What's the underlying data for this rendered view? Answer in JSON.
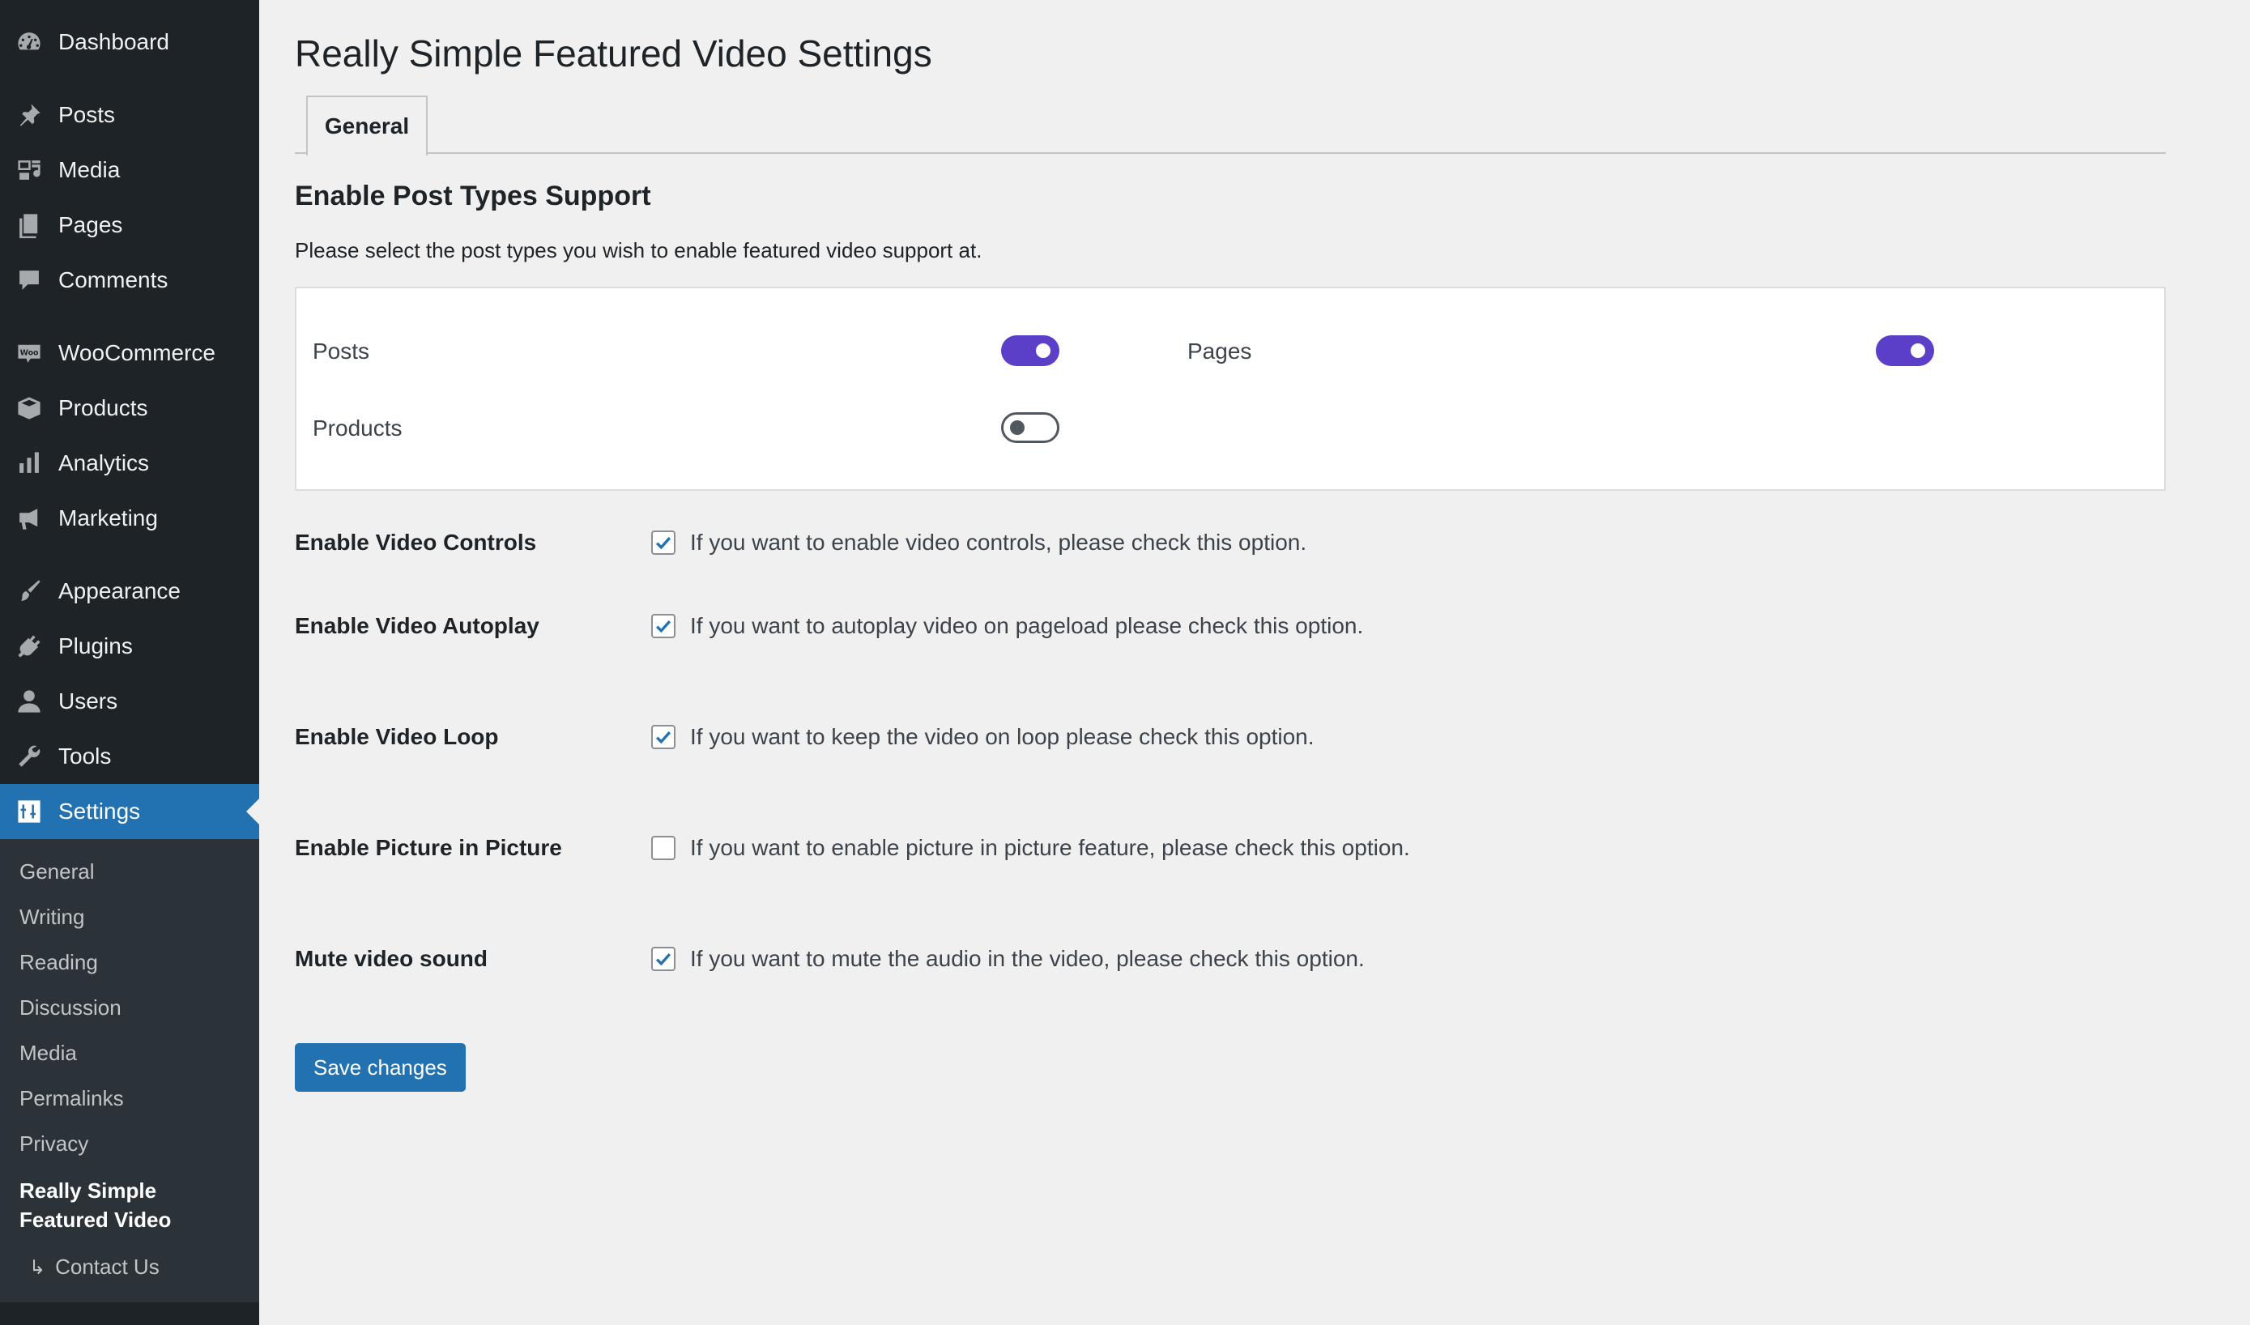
{
  "sidebar": {
    "group1": [
      {
        "label": "Dashboard",
        "icon": "dashboard-icon"
      }
    ],
    "group2": [
      {
        "label": "Posts",
        "icon": "pin-icon"
      },
      {
        "label": "Media",
        "icon": "media-icon"
      },
      {
        "label": "Pages",
        "icon": "pages-icon"
      },
      {
        "label": "Comments",
        "icon": "comment-icon"
      }
    ],
    "group3": [
      {
        "label": "WooCommerce",
        "icon": "woo-icon"
      },
      {
        "label": "Products",
        "icon": "box-icon"
      },
      {
        "label": "Analytics",
        "icon": "bar-chart-icon"
      },
      {
        "label": "Marketing",
        "icon": "megaphone-icon"
      }
    ],
    "group4": [
      {
        "label": "Appearance",
        "icon": "brush-icon"
      },
      {
        "label": "Plugins",
        "icon": "plug-icon"
      },
      {
        "label": "Users",
        "icon": "user-icon"
      },
      {
        "label": "Tools",
        "icon": "wrench-icon"
      },
      {
        "label": "Settings",
        "icon": "sliders-icon"
      }
    ],
    "submenu": {
      "general": "General",
      "writing": "Writing",
      "reading": "Reading",
      "discussion": "Discussion",
      "media": "Media",
      "permalinks": "Permalinks",
      "privacy": "Privacy",
      "rsfv_line1": "Really Simple",
      "rsfv_line2": "Featured Video",
      "contact_arrow": "↳",
      "contact": "Contact Us"
    }
  },
  "main": {
    "title": "Really Simple Featured Video Settings",
    "tab_general": "General",
    "section_title": "Enable Post Types Support",
    "section_desc": "Please select the post types you wish to enable featured video support at.",
    "post_types": {
      "posts": {
        "label": "Posts",
        "enabled": true
      },
      "pages": {
        "label": "Pages",
        "enabled": true
      },
      "products": {
        "label": "Products",
        "enabled": false
      }
    },
    "options": [
      {
        "label": "Enable Video Controls",
        "desc": "If you want to enable video controls, please check this option.",
        "checked": true
      },
      {
        "label": "Enable Video Autoplay",
        "desc": "If you want to autoplay video on pageload please check this option.",
        "checked": true
      },
      {
        "label": "Enable Video Loop",
        "desc": "If you want to keep the video on loop please check this option.",
        "checked": true
      },
      {
        "label": "Enable Picture in Picture",
        "desc": "If you want to enable picture in picture feature, please check this option.",
        "checked": false
      },
      {
        "label": "Mute video sound",
        "desc": "If you want to mute the audio in the video, please check this option.",
        "checked": true
      }
    ],
    "save_label": "Save changes"
  },
  "colors": {
    "sidebar_bg": "#1d2327",
    "submenu_bg": "#2c3338",
    "accent": "#2271b1",
    "toggle_on": "#5b3fc9"
  }
}
